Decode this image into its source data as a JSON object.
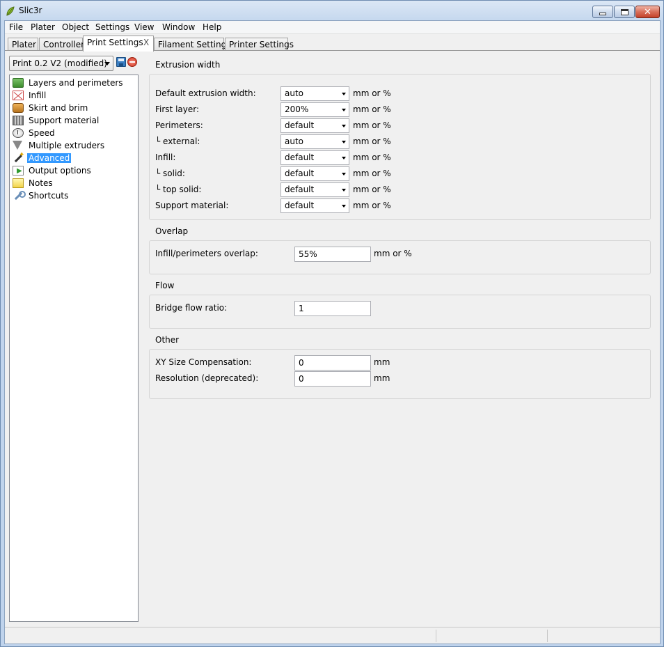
{
  "window": {
    "title": "Slic3r"
  },
  "menu": [
    "File",
    "Plater",
    "Object",
    "Settings",
    "View",
    "Window",
    "Help"
  ],
  "tabs": {
    "plater": "Plater",
    "controller": "Controller",
    "print_settings": "Print Settings",
    "close_glyph": "X",
    "filament_settings": "Filament Settings",
    "printer_settings": "Printer Settings"
  },
  "preset": {
    "selected": "Print 0.2 V2 (modified)"
  },
  "pages": [
    {
      "label": "Layers and perimeters",
      "icon": "layers-icon"
    },
    {
      "label": "Infill",
      "icon": "infill-icon"
    },
    {
      "label": "Skirt and brim",
      "icon": "skirt-icon"
    },
    {
      "label": "Support material",
      "icon": "support-icon"
    },
    {
      "label": "Speed",
      "icon": "speed-icon"
    },
    {
      "label": "Multiple extruders",
      "icon": "funnel-icon"
    },
    {
      "label": "Advanced",
      "icon": "wand-icon",
      "selected": true
    },
    {
      "label": "Output options",
      "icon": "output-icon"
    },
    {
      "label": "Notes",
      "icon": "notes-icon"
    },
    {
      "label": "Shortcuts",
      "icon": "wrench-icon"
    }
  ],
  "extrusion_width": {
    "title": "Extrusion width",
    "rows": [
      {
        "label": "Default extrusion width:",
        "value": "auto",
        "unit": "mm or %"
      },
      {
        "label": "First layer:",
        "value": "200%",
        "unit": "mm or %"
      },
      {
        "label": "Perimeters:",
        "value": "default",
        "unit": "mm or %"
      },
      {
        "label": "└ external:",
        "value": "auto",
        "unit": "mm or %"
      },
      {
        "label": "Infill:",
        "value": "default",
        "unit": "mm or %"
      },
      {
        "label": "└ solid:",
        "value": "default",
        "unit": "mm or %"
      },
      {
        "label": "└ top solid:",
        "value": "default",
        "unit": "mm or %"
      },
      {
        "label": "Support material:",
        "value": "default",
        "unit": "mm or %"
      }
    ]
  },
  "overlap": {
    "title": "Overlap",
    "label": "Infill/perimeters overlap:",
    "value": "55%",
    "unit": "mm or %"
  },
  "flow": {
    "title": "Flow",
    "label": "Bridge flow ratio:",
    "value": "1"
  },
  "other": {
    "title": "Other",
    "xy_label": "XY Size Compensation:",
    "xy_value": "0",
    "xy_unit": "mm",
    "res_label": "Resolution (deprecated):",
    "res_value": "0",
    "res_unit": "mm"
  }
}
